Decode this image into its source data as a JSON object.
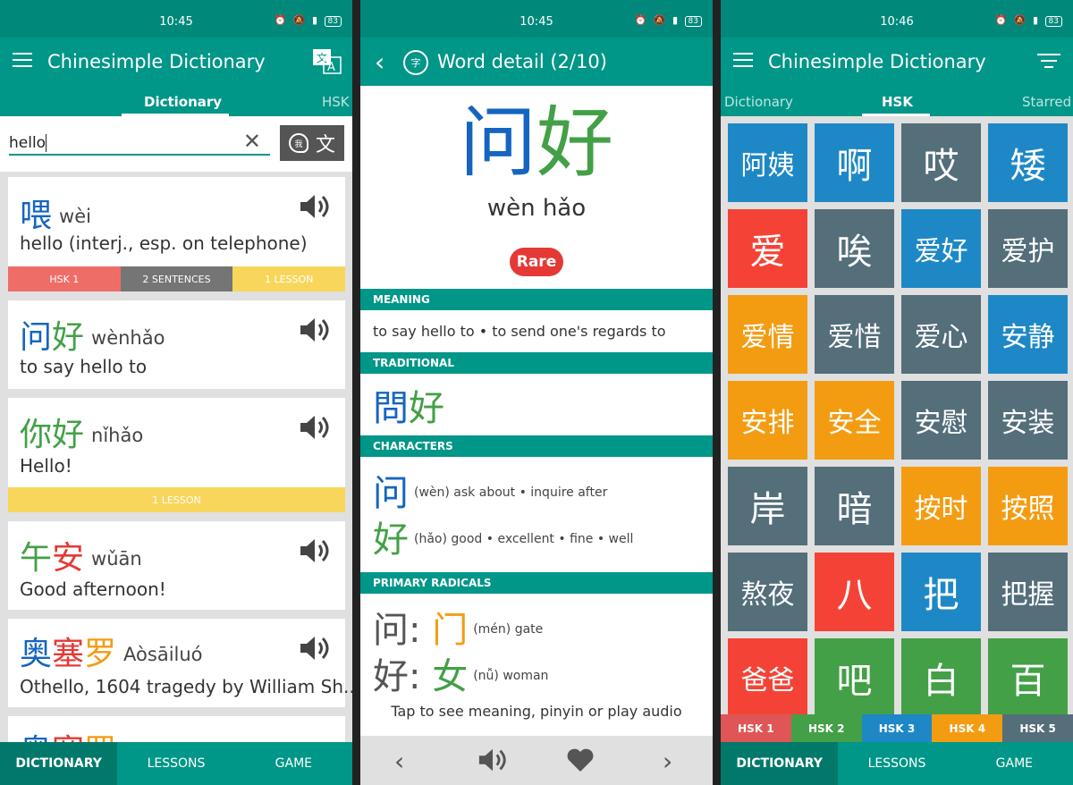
{
  "status": {
    "time1": "10:45",
    "time2": "10:45",
    "time3": "10:46",
    "battery": "83"
  },
  "s1": {
    "title": "Chinesimple Dictionary",
    "tabs": [
      "Dictionary",
      "HSK"
    ],
    "search_value": "hello",
    "handwrite_char": "文",
    "results": [
      {
        "word": "喂",
        "pinyin": "wèi",
        "def": "hello (interj., esp. on telephone)",
        "badges": [
          "HSK 1",
          "2 SENTENCES",
          "1 LESSON"
        ]
      },
      {
        "word": "问好",
        "pinyin": "wènhǎo",
        "def": "to say hello to"
      },
      {
        "word": "你好",
        "pinyin": "nǐhǎo",
        "def": "Hello!",
        "badges": [
          "1 LESSON"
        ]
      },
      {
        "word": "午安",
        "pinyin": "wǔān",
        "def": "Good afternoon!"
      },
      {
        "word": "奥塞罗",
        "pinyin": "Aòsāiluó",
        "def": "Othello, 1604 tragedy by William Sh..."
      }
    ],
    "partial_word": "奥塞罗",
    "nav": [
      "DICTIONARY",
      "LESSONS",
      "GAME"
    ]
  },
  "s2": {
    "title": "Word detail (2/10)",
    "word": "问好",
    "pinyin": "wèn hǎo",
    "rare": "Rare",
    "meaning_head": "MEANING",
    "meaning": "to say hello to • to send one's regards to",
    "trad_head": "TRADITIONAL",
    "trad": "問好",
    "chars_head": "CHARACTERS",
    "chars": [
      {
        "c": "问",
        "gloss": "(wèn) ask about •  inquire after"
      },
      {
        "c": "好",
        "gloss": "(hǎo) good •  excellent •  fine •  well"
      }
    ],
    "radicals_head": "PRIMARY RADICALS",
    "radicals": [
      {
        "c": "问:",
        "r": "门",
        "gloss": "(mén) gate"
      },
      {
        "c": "好:",
        "r": "女",
        "gloss": "(nǚ) woman"
      }
    ],
    "tap_hint": "Tap to see meaning, pinyin or play audio"
  },
  "s3": {
    "title": "Chinesimple Dictionary",
    "tabs": [
      "Dictionary",
      "HSK",
      "Starred"
    ],
    "tiles": [
      "阿姨",
      "啊",
      "哎",
      "矮",
      "爱",
      "唉",
      "爱好",
      "爱护",
      "爱情",
      "爱惜",
      "爱心",
      "安静",
      "安排",
      "安全",
      "安慰",
      "安装",
      "岸",
      "暗",
      "按时",
      "按照",
      "熬夜",
      "八",
      "把",
      "把握",
      "爸爸",
      "吧",
      "白",
      "百"
    ],
    "tile_colors": [
      "#1e88c7",
      "#1e88c7",
      "#546e7a",
      "#1e88c7",
      "#f44336",
      "#546e7a",
      "#1e88c7",
      "#546e7a",
      "#f39c12",
      "#546e7a",
      "#546e7a",
      "#1e88c7",
      "#f39c12",
      "#f39c12",
      "#546e7a",
      "#546e7a",
      "#546e7a",
      "#546e7a",
      "#f39c12",
      "#f39c12",
      "#546e7a",
      "#f44336",
      "#1e88c7",
      "#546e7a",
      "#f44336",
      "#43a047",
      "#43a047",
      "#43a047"
    ],
    "hsk_levels": [
      "HSK 1",
      "HSK 2",
      "HSK 3",
      "HSK 4",
      "HSK 5"
    ],
    "hsk_colors": [
      "#e05555",
      "#43a047",
      "#1e88c7",
      "#f39c12",
      "#546e7a"
    ],
    "nav": [
      "DICTIONARY",
      "LESSONS",
      "GAME"
    ]
  },
  "colors": {
    "primary": "#009688",
    "primary_dark": "#00796b",
    "rare": "#e53935"
  }
}
